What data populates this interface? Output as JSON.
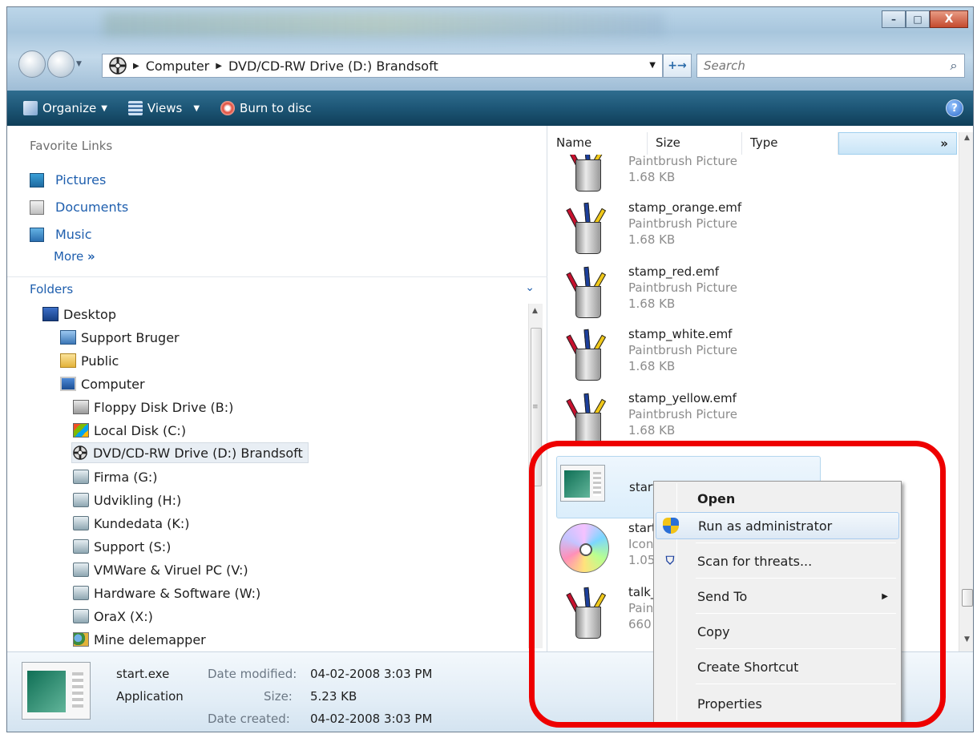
{
  "window": {
    "controls": {
      "minimize": "–",
      "maximize": "□",
      "close": "X"
    }
  },
  "address": {
    "crumbs": [
      "Computer",
      "DVD/CD-RW Drive (D:) Brandsoft"
    ],
    "search_placeholder": "Search",
    "refresh_glyph": "+→"
  },
  "toolbar": {
    "organize": "Organize",
    "views": "Views",
    "burn": "Burn to disc",
    "help": "?"
  },
  "left": {
    "favorites_title": "Favorite Links",
    "favorites": [
      "Pictures",
      "Documents",
      "Music"
    ],
    "more": "More",
    "folders_title": "Folders",
    "tree": [
      {
        "label": "Desktop",
        "icon": "desktop-icon"
      },
      {
        "label": "Support Bruger",
        "icon": "user-folder-icon"
      },
      {
        "label": "Public",
        "icon": "folder-icon"
      },
      {
        "label": "Computer",
        "icon": "computer-icon"
      },
      {
        "label": "Floppy Disk Drive (B:)",
        "icon": "floppy-icon"
      },
      {
        "label": "Local Disk (C:)",
        "icon": "disk-icon"
      },
      {
        "label": "DVD/CD-RW Drive (D:) Brandsoft",
        "icon": "dvd-icon"
      },
      {
        "label": "Firma (G:)",
        "icon": "network-drive-icon"
      },
      {
        "label": "Udvikling (H:)",
        "icon": "network-drive-icon"
      },
      {
        "label": "Kundedata (K:)",
        "icon": "network-drive-icon"
      },
      {
        "label": "Support (S:)",
        "icon": "network-drive-icon"
      },
      {
        "label": "VMWare & Viruel PC (V:)",
        "icon": "network-drive-icon"
      },
      {
        "label": "Hardware & Software (W:)",
        "icon": "network-drive-icon"
      },
      {
        "label": "OraX (X:)",
        "icon": "network-drive-icon"
      },
      {
        "label": "Mine delemapper",
        "icon": "shared-folder-icon"
      }
    ]
  },
  "columns": [
    "Name",
    "Size",
    "Type"
  ],
  "columns_more": "»",
  "files": [
    {
      "name": "",
      "type": "Paintbrush Picture",
      "size": "1.68 KB"
    },
    {
      "name": "stamp_orange.emf",
      "type": "Paintbrush Picture",
      "size": "1.68 KB"
    },
    {
      "name": "stamp_red.emf",
      "type": "Paintbrush Picture",
      "size": "1.68 KB"
    },
    {
      "name": "stamp_white.emf",
      "type": "Paintbrush Picture",
      "size": "1.68 KB"
    },
    {
      "name": "stamp_yellow.emf",
      "type": "Paintbrush Picture",
      "size": "1.68 KB"
    },
    {
      "name": "start.exe",
      "type": "",
      "size": ""
    },
    {
      "name": "start.",
      "type": "Icon",
      "size": "1.05"
    },
    {
      "name": "talk_",
      "type": "Paint",
      "size": "660 b"
    }
  ],
  "context_menu": {
    "open": "Open",
    "run_as_admin": "Run as administrator",
    "scan": "Scan for threats...",
    "send_to": "Send To",
    "copy": "Copy",
    "create_shortcut": "Create Shortcut",
    "properties": "Properties"
  },
  "details": {
    "name": "start.exe",
    "kind": "Application",
    "modified_label": "Date modified:",
    "modified": "04-02-2008 3:03 PM",
    "size_label": "Size:",
    "size": "5.23 KB",
    "created_label": "Date created:",
    "created": "04-02-2008 3:03 PM"
  },
  "colors": {
    "toolbar": "#1d5676",
    "link": "#1f5fae",
    "highlight": "#ee0000"
  }
}
